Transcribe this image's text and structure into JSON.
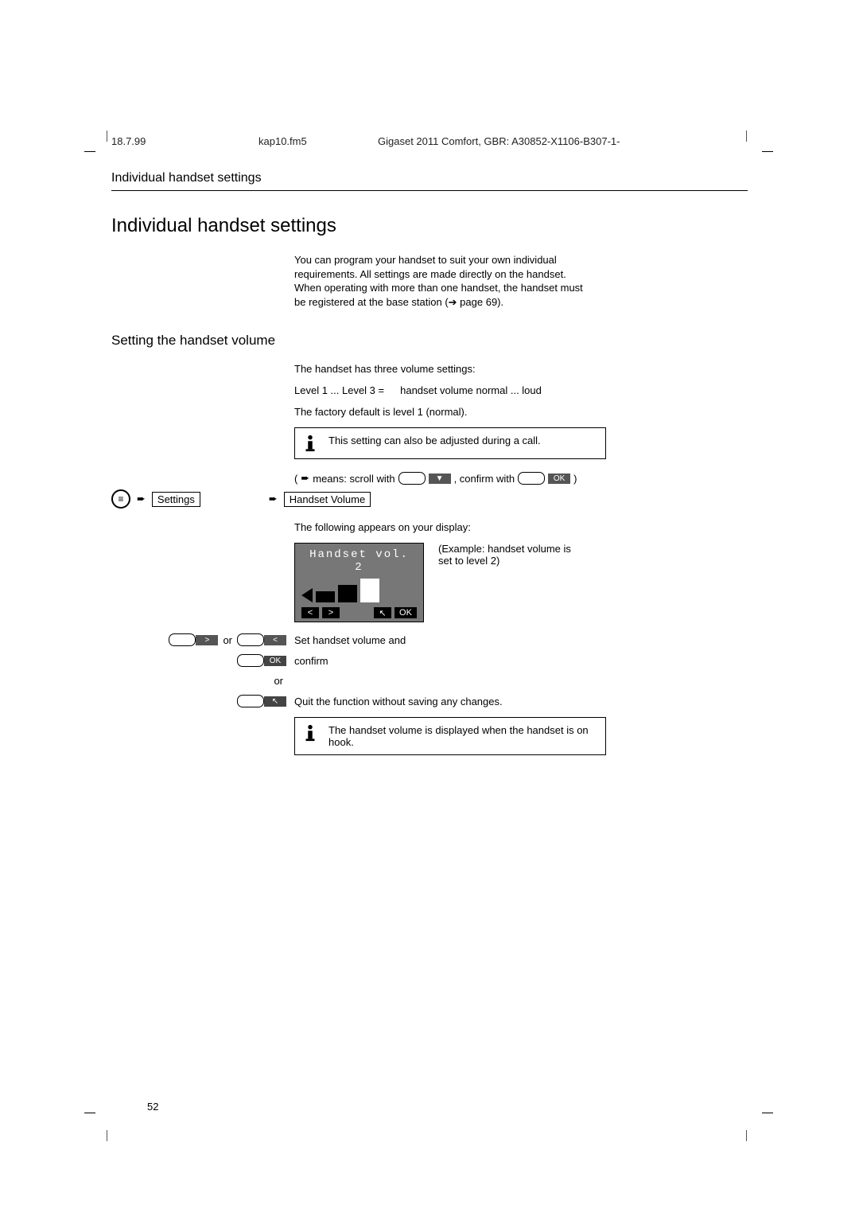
{
  "header": {
    "date": "18.7.99",
    "file": "kap10.fm5",
    "ref": "Gigaset 2011 Comfort, GBR: A30852-X1106-B307-1-"
  },
  "running_head": "Individual handset settings",
  "title": "Individual handset settings",
  "intro": "You can program your handset to suit your own individual requirements. All settings are made directly on the handset. When operating with more than one handset, the handset must be registered at the base station (➔ page 69).",
  "section": {
    "heading": "Setting the handset volume",
    "p1": "The handset has three volume settings:",
    "levels_l": "Level 1 ... Level 3   =",
    "levels_r": "handset volume normal ... loud",
    "p2": "The factory default is level 1 (normal).",
    "note1": "This setting can also be adjusted during a call.",
    "scroll_hint_pre": "(",
    "scroll_hint_mid1": " means: scroll with ",
    "scroll_hint_mid2": " , confirm with ",
    "scroll_hint_post": " )",
    "menu_item1": "Settings",
    "menu_item2": "Handset Volume",
    "p3": "The following appears on your display:",
    "display_title": "Handset vol. 2",
    "example": "(Example: handset volume is set to level 2)",
    "set_confirm": "Set handset volume and",
    "confirm": "confirm",
    "or": "or",
    "quit": "Quit the function without saving any changes.",
    "note2": "The handset volume is displayed when the handset is on hook."
  },
  "softkeys": {
    "left": "<",
    "right": ">",
    "back": "↖",
    "ok": "OK",
    "down": "▼"
  },
  "page_number": "52"
}
